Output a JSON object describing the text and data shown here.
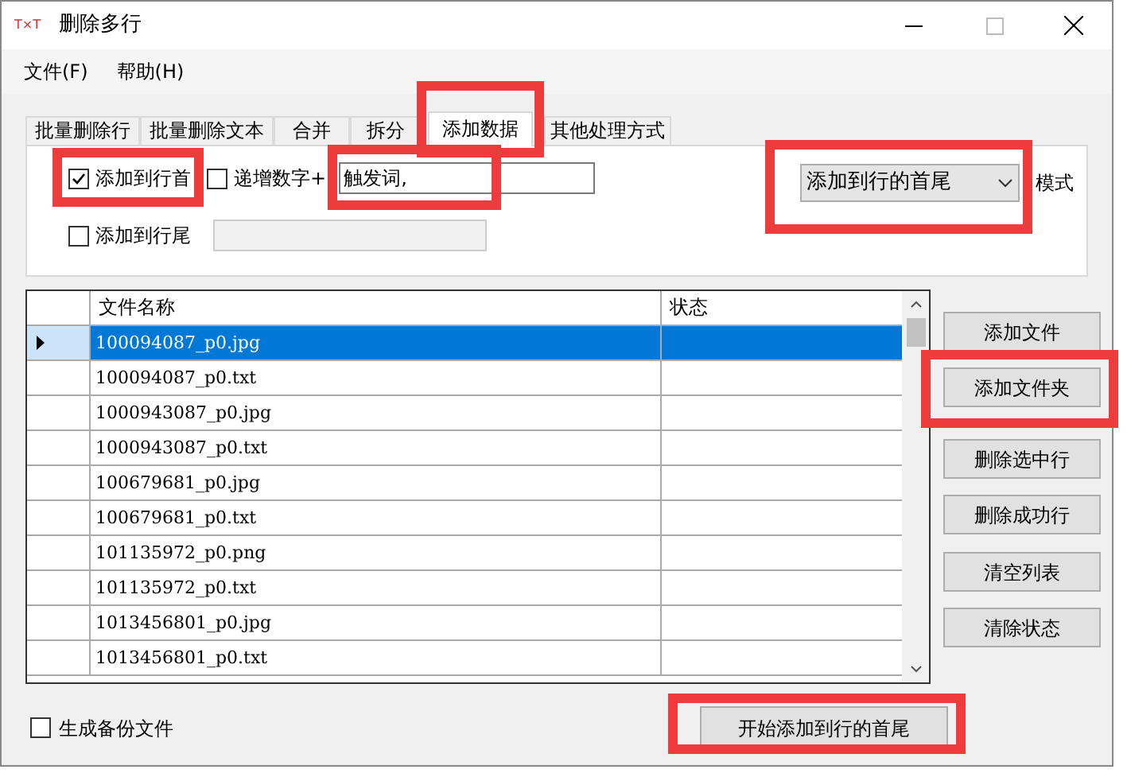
{
  "window": {
    "icon_text": "T×T",
    "title": "删除多行"
  },
  "menu": [
    "文件(F)",
    "帮助(H)"
  ],
  "tabs": [
    {
      "label": "批量删除行",
      "selected": false
    },
    {
      "label": "批量删除文本",
      "selected": false
    },
    {
      "label": "合并",
      "selected": false
    },
    {
      "label": "拆分",
      "selected": false
    },
    {
      "label": "添加数据",
      "selected": true,
      "highlight": true
    },
    {
      "label": "其他处理方式",
      "selected": false
    }
  ],
  "options": {
    "add_to_head": {
      "label": "添加到行首",
      "checked": true,
      "highlight": true
    },
    "increment": {
      "label": "递增数字+",
      "checked": false
    },
    "head_text": {
      "value": "触发词,",
      "highlight": true
    },
    "add_to_tail": {
      "label": "添加到行尾",
      "checked": false
    },
    "tail_text": {
      "disabled": true
    },
    "mode": {
      "value": "添加到行的首尾",
      "highlight": true,
      "label": "模式"
    }
  },
  "table": {
    "columns": [
      "文件名称",
      "状态"
    ],
    "rows": [
      {
        "name": "100094087_p0.jpg",
        "selected": true
      },
      {
        "name": "100094087_p0.txt",
        "selected": false
      },
      {
        "name": "1000943087_p0.jpg",
        "selected": false
      },
      {
        "name": "1000943087_p0.txt",
        "selected": false
      },
      {
        "name": "100679681_p0.jpg",
        "selected": false
      },
      {
        "name": "100679681_p0.txt",
        "selected": false
      },
      {
        "name": "101135972_p0.png",
        "selected": false
      },
      {
        "name": "101135972_p0.txt",
        "selected": false
      },
      {
        "name": "1013456801_p0.jpg",
        "selected": false
      },
      {
        "name": "1013456801_p0.txt",
        "selected": false
      }
    ]
  },
  "side_buttons": [
    {
      "label": "添加文件"
    },
    {
      "label": "添加文件夹",
      "highlight": true
    },
    {
      "label": "删除选中行"
    },
    {
      "label": "删除成功行"
    },
    {
      "label": "清空列表"
    },
    {
      "label": "清除状态"
    }
  ],
  "backup": {
    "label": "生成备份文件",
    "checked": false
  },
  "start_button": {
    "label": "开始添加到行的首尾",
    "highlight": true
  }
}
